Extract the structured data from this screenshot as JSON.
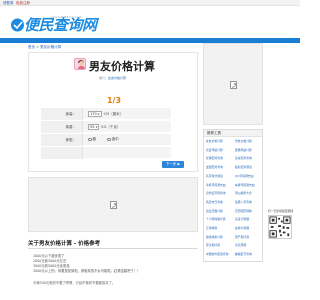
{
  "topbar": {
    "login": "请登录",
    "register": "免费注册"
  },
  "header": {
    "logo_text": "便民查询网",
    "logo_url": "www.BM8CX.com"
  },
  "breadcrumb": {
    "home": "首页",
    "sep": " > ",
    "current": "男友价格计算"
  },
  "main": {
    "title": "男友价格计算",
    "subline_prefix": "简介：",
    "subline_link": "女友价格计算",
    "progress": "1/3",
    "form": {
      "height_label": "身高：",
      "height_value": "170",
      "height_unit": "CM（厘米）",
      "weight_label": "体重：",
      "weight_value": "55",
      "weight_unit": "KG（千克）",
      "body_label": "体型：",
      "body_options": [
        "瘦",
        "适中"
      ]
    },
    "next_button": "下一步 ▶"
  },
  "article": {
    "title": "关于男友价格计算 - 价格参考",
    "lines": [
      "1000元以下超优惠了",
      "2000元到3000元左右",
      "3000元到5000元优质品",
      "5000元以上的，你要是找到啦，那就真的不太可能啦，赶紧结婚吧了！！",
      "不满500元就别不要了吧啊，已经不像样不要都保存了。"
    ]
  },
  "sidebar": {
    "box_title": "推荐工具",
    "links": [
      "女友价格计算",
      "男友价格计算",
      "恋爱年龄计算",
      "结婚年龄计算",
      "星座配对查询",
      "生肖配对查询",
      "血型配对查询",
      "姓名配对测试",
      "名字缘分测试",
      "QQ号码测吉凶",
      "手机号码测吉凶",
      "车牌号码测吉凶",
      "身份证号码查询",
      "周公解梦大全",
      "黄道吉日查询",
      "生辰八字查询",
      "出生天数计算",
      "农历阳历转换",
      "个人所得税计算",
      "房贷计算器",
      "汇率换算",
      "在线计算器",
      "健康体重计算",
      "预产期计算",
      "安全期计算",
      "身高预测",
      "中国省市区划查询",
      "邮编区号查询"
    ],
    "qr_label": "扫一扫手机版更便捷"
  }
}
